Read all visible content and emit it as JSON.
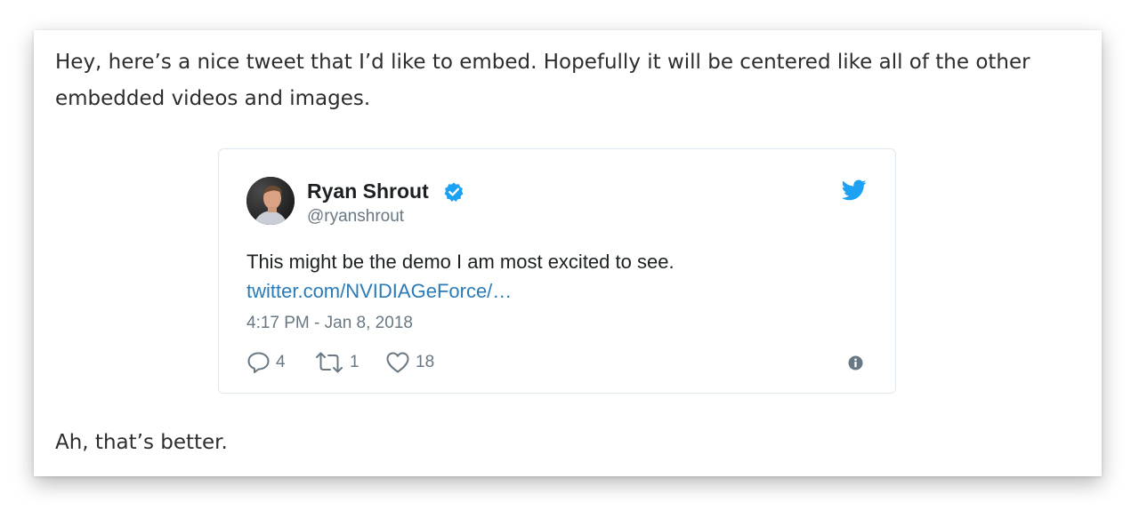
{
  "article": {
    "paragraph_1": "Hey, here’s a nice tweet that I’d like to embed. Hopefully it will be centered like all of the other embedded videos and images.",
    "paragraph_2": "Ah, that’s better."
  },
  "tweet": {
    "author_name": "Ryan Shrout",
    "author_handle": "@ryanshrout",
    "text": "This might be the demo I am most excited to see.",
    "link_text": "twitter.com/NVIDIAGeForce/…",
    "timestamp": "4:17 PM - Jan 8, 2018",
    "reply_count": "4",
    "retweet_count": "1",
    "like_count": "18",
    "icons": {
      "avatar": "avatar",
      "verified": "verified-badge-icon",
      "brand": "twitter-bird-icon",
      "reply": "reply-icon",
      "retweet": "retweet-icon",
      "like": "heart-icon",
      "info": "info-icon"
    }
  },
  "colors": {
    "text": "#2d2d2d",
    "tweet_text": "#1c2022",
    "muted": "#697882",
    "link": "#2b7bb9",
    "twitter_blue": "#1da1f2",
    "border": "#e1e8ed"
  }
}
